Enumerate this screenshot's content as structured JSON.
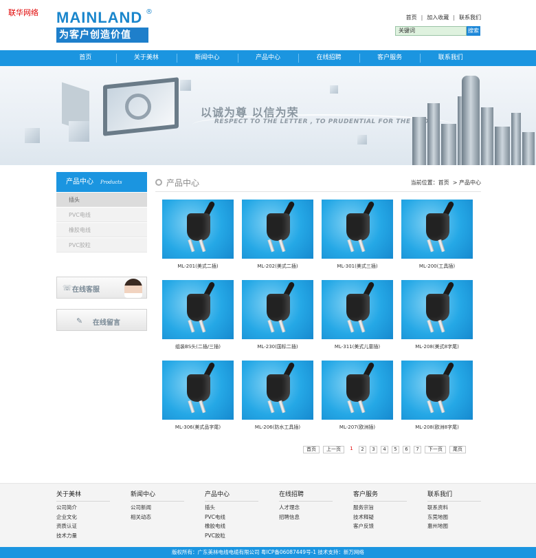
{
  "watermark": "联华网络",
  "logo": {
    "brand": "MAINLAND",
    "slogan": "为客户创造价值"
  },
  "toplinks": [
    "首页",
    "加入收藏",
    "联系我们"
  ],
  "search": {
    "value": "关键词",
    "button": "搜索"
  },
  "nav": [
    "首页",
    "关于美林",
    "新闻中心",
    "产品中心",
    "在线招聘",
    "客户服务",
    "联系我们"
  ],
  "banner": {
    "text_cn": "以诚为尊 以信为荣",
    "text_en": "RESPECT TO THE LETTER , TO PRUDENTIAL FOR THE PROUD"
  },
  "sidebar": {
    "title": "产品中心",
    "title_en": "Products",
    "items": [
      "插头",
      "PVC电线",
      "橡胶电线",
      "PVC胶粒"
    ],
    "service": "在线客服",
    "message": "在线留言"
  },
  "main": {
    "title": "产品中心",
    "breadcrumb_label": "当前位置：",
    "breadcrumb": [
      "首页",
      "产品中心"
    ],
    "products": [
      "ML-201(美式二插)",
      "ML-202(美式二插)",
      "ML-301(美式三插)",
      "ML-200(工具插)",
      "组装BS头(二插/三插)",
      "ML-230(国标二插)",
      "ML-311(美式儿童插)",
      "ML-208(美式8字尾)",
      "ML-306(美式品字尾)",
      "ML-206(防水工具插)",
      "ML-207(欧洲插)",
      "ML-208(欧洲8字尾)"
    ]
  },
  "pager": {
    "first": "首页",
    "prev": "上一页",
    "pages": [
      "1",
      "2",
      "3",
      "4",
      "5",
      "6",
      "7"
    ],
    "current": "1",
    "next": "下一页",
    "last": "尾页"
  },
  "footer": {
    "columns": [
      {
        "title": "关于美林",
        "links": [
          "公司简介",
          "企业文化",
          "资质认证",
          "技术力量"
        ]
      },
      {
        "title": "新闻中心",
        "links": [
          "公司新闻",
          "相关动态"
        ]
      },
      {
        "title": "产品中心",
        "links": [
          "插头",
          "PVC电线",
          "橡胶电线",
          "PVC胶粒"
        ]
      },
      {
        "title": "在线招聘",
        "links": [
          "人才理念",
          "招聘信息"
        ]
      },
      {
        "title": "客户服务",
        "links": [
          "服务宗旨",
          "技术释疑",
          "客户反馈"
        ]
      },
      {
        "title": "联系我们",
        "links": [
          "联系资料",
          "东莞地图",
          "惠州地图"
        ]
      }
    ],
    "copyright": "版权所有：广东美林电线电缆有限公司   粤ICP备06087449号-1   技术支持：新万网络"
  },
  "colors": {
    "brand_blue": "#1b95e0",
    "red": "#e00000"
  }
}
